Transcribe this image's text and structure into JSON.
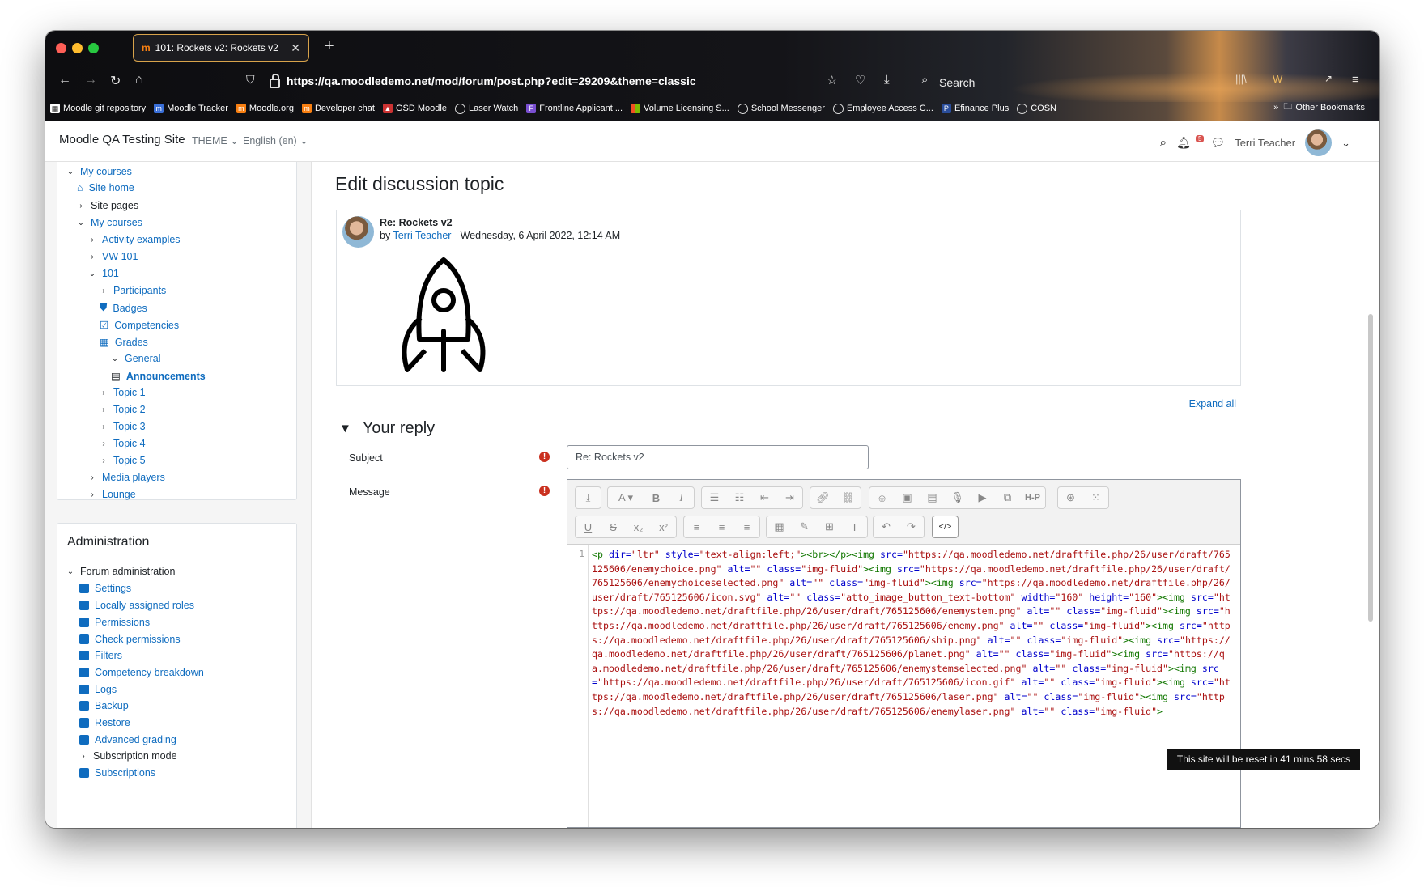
{
  "browser": {
    "tab_title": "101: Rockets v2: Rockets v2",
    "url": "https://qa.moodledemo.net/mod/forum/post.php?edit=29209&theme=classic",
    "search_label": "Search",
    "bookmarks": [
      "Moodle git repository",
      "Moodle Tracker",
      "Moodle.org",
      "Developer chat",
      "GSD Moodle",
      "Laser Watch",
      "Frontline Applicant ...",
      "Volume Licensing S...",
      "School Messenger",
      "Employee Access C...",
      "Efinance Plus",
      "COSN"
    ],
    "other_bookmarks": "Other Bookmarks"
  },
  "header": {
    "site_name": "Moodle QA Testing Site",
    "theme_menu": "THEME",
    "language_menu": "English (en)",
    "notification_count": "5",
    "user_name": "Terri Teacher"
  },
  "nav": {
    "my_courses_top": "My courses",
    "site_home": "Site home",
    "site_pages": "Site pages",
    "my_courses": "My courses",
    "activity_examples": "Activity examples",
    "vw101": "VW 101",
    "c101": "101",
    "participants": "Participants",
    "badges": "Badges",
    "competencies": "Competencies",
    "grades": "Grades",
    "general": "General",
    "announcements": "Announcements",
    "topics": [
      "Topic 1",
      "Topic 2",
      "Topic 3",
      "Topic 4",
      "Topic 5"
    ],
    "media_players": "Media players",
    "lounge": "Lounge"
  },
  "admin": {
    "title": "Administration",
    "forum_admin": "Forum administration",
    "items": [
      "Settings",
      "Locally assigned roles",
      "Permissions",
      "Check permissions",
      "Filters",
      "Competency breakdown",
      "Logs",
      "Backup",
      "Restore",
      "Advanced grading"
    ],
    "subscription_mode": "Subscription mode",
    "subscriptions": "Subscriptions"
  },
  "main": {
    "page_title": "Edit discussion topic",
    "post_subject": "Re: Rockets v2",
    "post_by": "by",
    "post_author": "Terri Teacher",
    "post_date": " - Wednesday, 6 April 2022, 12:14 AM",
    "expand_all": "Expand all",
    "section_title": "Your reply",
    "subject_label": "Subject",
    "subject_value": "Re: Rockets v2",
    "message_label": "Message",
    "line_number": "1",
    "toast": "This site will be reset in 41 mins 58 secs"
  },
  "colors": {
    "link": "#0f6cbf",
    "required": "#ca3120",
    "code_tag": "#117700",
    "code_attr": "#0000cc",
    "code_value": "#aa1111"
  },
  "html_source": [
    {
      "k": "tag",
      "t": "<p"
    },
    {
      "k": "attr",
      "t": " dir="
    },
    {
      "k": "val",
      "t": "\"ltr\""
    },
    {
      "k": "attr",
      "t": " style="
    },
    {
      "k": "val",
      "t": "\"text-align:left;\""
    },
    {
      "k": "tag",
      "t": "><br></p><img"
    },
    {
      "k": "attr",
      "t": " src="
    },
    {
      "k": "val",
      "t": "\"https://qa.moodledemo.net/draftfile.php/26/user/draft/765125606/enemychoice.png\""
    },
    {
      "k": "attr",
      "t": " alt="
    },
    {
      "k": "val",
      "t": "\"\""
    },
    {
      "k": "attr",
      "t": " class="
    },
    {
      "k": "val",
      "t": "\"img-fluid\""
    },
    {
      "k": "tag",
      "t": "><img"
    },
    {
      "k": "attr",
      "t": " src="
    },
    {
      "k": "val",
      "t": "\"https://qa.moodledemo.net/draftfile.php/26/user/draft/765125606/enemychoiceselected.png\""
    },
    {
      "k": "attr",
      "t": " alt="
    },
    {
      "k": "val",
      "t": "\"\""
    },
    {
      "k": "attr",
      "t": " class="
    },
    {
      "k": "val",
      "t": "\"img-fluid\""
    },
    {
      "k": "tag",
      "t": "><img"
    },
    {
      "k": "attr",
      "t": " src="
    },
    {
      "k": "val",
      "t": "\"https://qa.moodledemo.net/draftfile.php/26/user/draft/765125606/icon.svg\""
    },
    {
      "k": "attr",
      "t": " alt="
    },
    {
      "k": "val",
      "t": "\"\""
    },
    {
      "k": "attr",
      "t": " class="
    },
    {
      "k": "val",
      "t": "\"atto_image_button_text-bottom\""
    },
    {
      "k": "attr",
      "t": " width="
    },
    {
      "k": "val",
      "t": "\"160\""
    },
    {
      "k": "attr",
      "t": " height="
    },
    {
      "k": "val",
      "t": "\"160\""
    },
    {
      "k": "tag",
      "t": "><img"
    },
    {
      "k": "attr",
      "t": " src="
    },
    {
      "k": "val",
      "t": "\"https://qa.moodledemo.net/draftfile.php/26/user/draft/765125606/enemystem.png\""
    },
    {
      "k": "attr",
      "t": " alt="
    },
    {
      "k": "val",
      "t": "\"\""
    },
    {
      "k": "attr",
      "t": " class="
    },
    {
      "k": "val",
      "t": "\"img-fluid\""
    },
    {
      "k": "tag",
      "t": "><img"
    },
    {
      "k": "attr",
      "t": " src="
    },
    {
      "k": "val",
      "t": "\"https://qa.moodledemo.net/draftfile.php/26/user/draft/765125606/enemy.png\""
    },
    {
      "k": "attr",
      "t": " alt="
    },
    {
      "k": "val",
      "t": "\"\""
    },
    {
      "k": "attr",
      "t": " class="
    },
    {
      "k": "val",
      "t": "\"img-fluid\""
    },
    {
      "k": "tag",
      "t": "><img"
    },
    {
      "k": "attr",
      "t": " src="
    },
    {
      "k": "val",
      "t": "\"https://qa.moodledemo.net/draftfile.php/26/user/draft/765125606/ship.png\""
    },
    {
      "k": "attr",
      "t": " alt="
    },
    {
      "k": "val",
      "t": "\"\""
    },
    {
      "k": "attr",
      "t": " class="
    },
    {
      "k": "val",
      "t": "\"img-fluid\""
    },
    {
      "k": "tag",
      "t": "><img"
    },
    {
      "k": "attr",
      "t": " src="
    },
    {
      "k": "val",
      "t": "\"https://qa.moodledemo.net/draftfile.php/26/user/draft/765125606/planet.png\""
    },
    {
      "k": "attr",
      "t": " alt="
    },
    {
      "k": "val",
      "t": "\"\""
    },
    {
      "k": "attr",
      "t": " class="
    },
    {
      "k": "val",
      "t": "\"img-fluid\""
    },
    {
      "k": "tag",
      "t": "><img"
    },
    {
      "k": "attr",
      "t": " src="
    },
    {
      "k": "val",
      "t": "\"https://qa.moodledemo.net/draftfile.php/26/user/draft/765125606/enemystemselected.png\""
    },
    {
      "k": "attr",
      "t": " alt="
    },
    {
      "k": "val",
      "t": "\"\""
    },
    {
      "k": "attr",
      "t": " class="
    },
    {
      "k": "val",
      "t": "\"img-fluid\""
    },
    {
      "k": "tag",
      "t": "><img"
    },
    {
      "k": "attr",
      "t": " src="
    },
    {
      "k": "val",
      "t": "\"https://qa.moodledemo.net/draftfile.php/26/user/draft/765125606/icon.gif\""
    },
    {
      "k": "attr",
      "t": " alt="
    },
    {
      "k": "val",
      "t": "\"\""
    },
    {
      "k": "attr",
      "t": " class="
    },
    {
      "k": "val",
      "t": "\"img-fluid\""
    },
    {
      "k": "tag",
      "t": "><img"
    },
    {
      "k": "attr",
      "t": " src="
    },
    {
      "k": "val",
      "t": "\"https://qa.moodledemo.net/draftfile.php/26/user/draft/765125606/laser.png\""
    },
    {
      "k": "attr",
      "t": " alt="
    },
    {
      "k": "val",
      "t": "\"\""
    },
    {
      "k": "attr",
      "t": " class="
    },
    {
      "k": "val",
      "t": "\"img-fluid\""
    },
    {
      "k": "tag",
      "t": "><img"
    },
    {
      "k": "attr",
      "t": " src="
    },
    {
      "k": "val",
      "t": "\"https://qa.moodledemo.net/draftfile.php/26/user/draft/765125606/enemylaser.png\""
    },
    {
      "k": "attr",
      "t": " alt="
    },
    {
      "k": "val",
      "t": "\"\""
    },
    {
      "k": "attr",
      "t": " class="
    },
    {
      "k": "val",
      "t": "\"img-fluid\""
    },
    {
      "k": "tag",
      "t": ">"
    }
  ]
}
